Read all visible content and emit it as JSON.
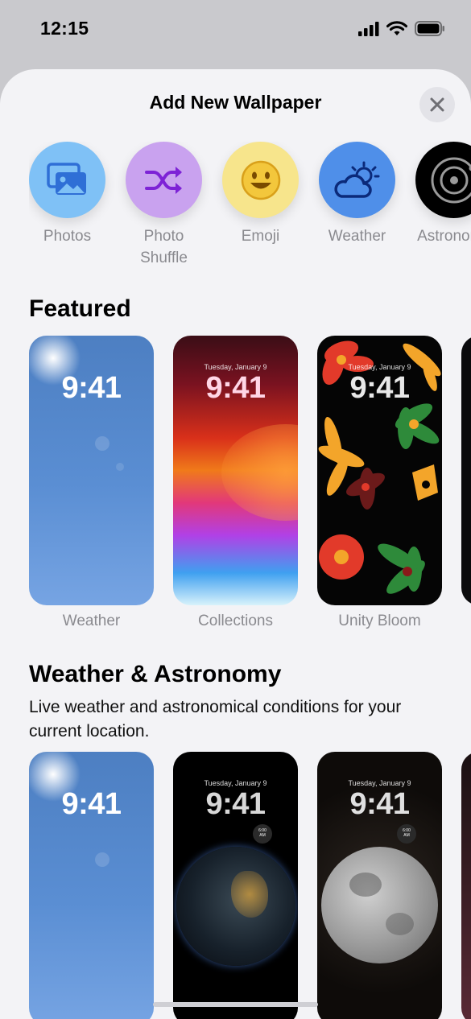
{
  "status": {
    "time": "12:15"
  },
  "sheet": {
    "title": "Add New Wallpaper"
  },
  "categories": [
    {
      "label": "Photos",
      "icon": "photos-icon",
      "color": "#7fc1f6"
    },
    {
      "label": "Photo\nShuffle",
      "icon": "shuffle-icon",
      "color": "#c9a2ef"
    },
    {
      "label": "Emoji",
      "icon": "emoji-icon",
      "color": "#f7e58c"
    },
    {
      "label": "Weather",
      "icon": "weather-icon",
      "color": "#4f8fe9"
    },
    {
      "label": "Astronomy",
      "icon": "astronomy-icon",
      "color": "#000000"
    }
  ],
  "featured": {
    "title": "Featured",
    "cards": [
      {
        "label": "Weather",
        "time": "9:41",
        "date": ""
      },
      {
        "label": "Collections",
        "time": "9:41",
        "date": "Tuesday, January 9"
      },
      {
        "label": "Unity Bloom",
        "time": "9:41",
        "date": "Tuesday, January 9"
      }
    ]
  },
  "weather_astronomy": {
    "title": "Weather & Astronomy",
    "subtitle": "Live weather and astronomical conditions for your current location.",
    "cards": [
      {
        "time": "9:41",
        "date": ""
      },
      {
        "time": "9:41",
        "date": "Tuesday, January 9",
        "widget": "6:00\nAM"
      },
      {
        "time": "9:41",
        "date": "Tuesday, January 9",
        "widget": "6:00\nAM"
      }
    ]
  }
}
